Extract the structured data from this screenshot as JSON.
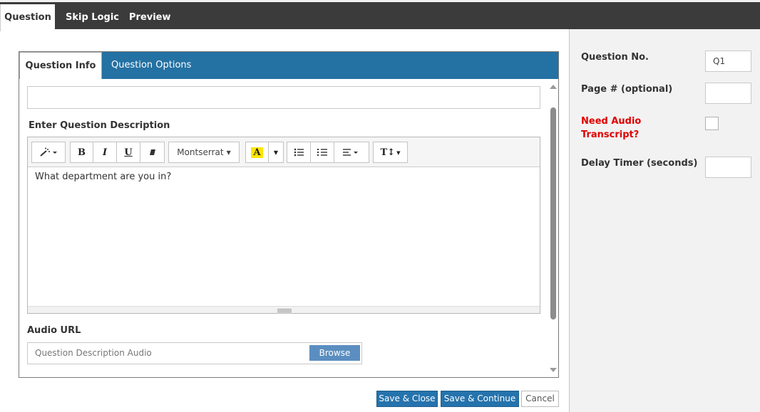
{
  "top_tabs": [
    {
      "label": "Question",
      "active": true
    },
    {
      "label": "Skip Logic",
      "active": false
    },
    {
      "label": "Preview",
      "active": false
    }
  ],
  "inner_tabs": [
    {
      "label": "Question Info",
      "active": true
    },
    {
      "label": "Question Options",
      "active": false
    }
  ],
  "form": {
    "title_value": "",
    "description_label": "Enter Question Description",
    "description_text": "What department are you in?",
    "audio_label": "Audio URL",
    "audio_placeholder": "Question Description Audio",
    "browse_label": "Browse"
  },
  "toolbar": {
    "font_name": "Montserrat",
    "bold": "B",
    "italic": "I",
    "underline": "U",
    "highlight_letter": "A",
    "text_size": "T↕"
  },
  "side": {
    "question_no_label": "Question No.",
    "question_no_value": "Q1",
    "page_label": "Page # (optional)",
    "page_value": "",
    "audio_transcript_label_1": "Need Audio",
    "audio_transcript_label_2": "Transcript?",
    "audio_transcript_checked": false,
    "delay_label": "Delay Timer (seconds)",
    "delay_value": ""
  },
  "footer": {
    "save_close": "Save & Close",
    "save_continue": "Save & Continue",
    "cancel": "Cancel"
  },
  "colors": {
    "topbar": "#3b3b3b",
    "tab_accent": "#2471a3",
    "primary_button": "#2573ad",
    "required_label": "#e00000"
  }
}
